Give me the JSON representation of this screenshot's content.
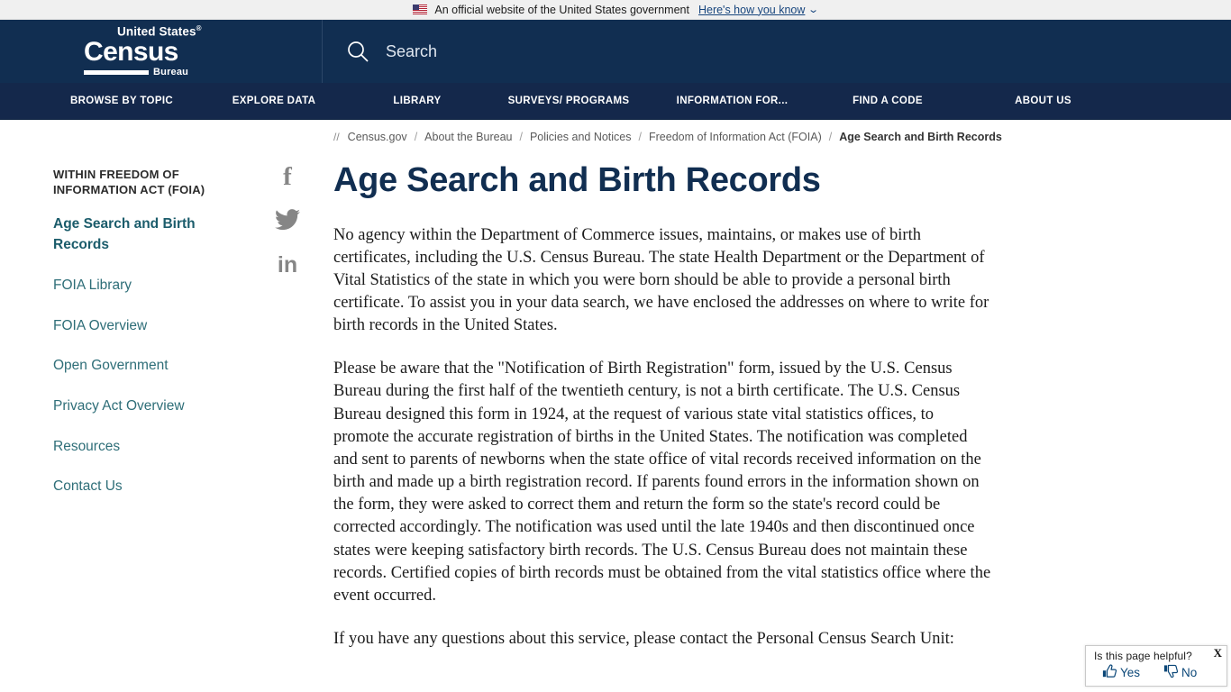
{
  "gov_banner": {
    "flag_icon": "us-flag-icon",
    "text": "An official website of the United States government",
    "link_label": "Here's how you know",
    "chevron_icon": "chevron-down-icon"
  },
  "header": {
    "logo": {
      "united_states": "United States",
      "registered_mark": "®",
      "census": "Census",
      "bureau": "Bureau"
    },
    "search": {
      "icon": "search-icon",
      "label": "Search",
      "placeholder": "Search"
    }
  },
  "main_nav": {
    "items": [
      {
        "label": "BROWSE BY TOPIC"
      },
      {
        "label": "EXPLORE DATA"
      },
      {
        "label": "LIBRARY"
      },
      {
        "label": "SURVEYS/ PROGRAMS"
      },
      {
        "label": "INFORMATION FOR..."
      },
      {
        "label": "FIND A CODE"
      },
      {
        "label": "ABOUT US"
      }
    ]
  },
  "breadcrumb": {
    "prefix": "//",
    "items": [
      {
        "label": "Census.gov",
        "current": false
      },
      {
        "label": "About the Bureau",
        "current": false
      },
      {
        "label": "Policies and Notices",
        "current": false
      },
      {
        "label": "Freedom of Information Act (FOIA)",
        "current": false
      },
      {
        "label": "Age Search and Birth Records",
        "current": true
      }
    ],
    "separator": "/"
  },
  "sidebar": {
    "section_title": "WITHIN FREEDOM OF INFORMATION ACT (FOIA)",
    "items": [
      {
        "label": "Age Search and Birth Records",
        "active": true
      },
      {
        "label": "FOIA Library",
        "active": false
      },
      {
        "label": "FOIA Overview",
        "active": false
      },
      {
        "label": "Open Government",
        "active": false
      },
      {
        "label": "Privacy Act Overview",
        "active": false
      },
      {
        "label": "Resources",
        "active": false
      },
      {
        "label": "Contact Us",
        "active": false
      }
    ],
    "social": [
      {
        "icon": "facebook-icon",
        "glyph": "f"
      },
      {
        "icon": "twitter-icon",
        "glyph": ""
      },
      {
        "icon": "linkedin-icon",
        "glyph": "in"
      }
    ]
  },
  "main": {
    "title": "Age Search and Birth Records",
    "paragraphs": [
      "No agency within the Department of Commerce issues, maintains, or makes use of birth certificates, including the U.S. Census Bureau. The state Health Department or the Department of Vital Statistics of the state in which you were born should be able to provide a personal birth certificate. To assist you in your data search, we have enclosed the addresses on where to write for birth records in the United States.",
      "Please be aware that the \"Notification of Birth Registration\" form, issued by the U.S. Census Bureau during the first half of the twentieth century, is not a birth certificate. The U.S. Census Bureau designed this form in 1924, at the request of various state vital statistics offices, to promote the accurate registration of births in the United States. The notification was completed and sent to parents of newborns when the state office of vital records received information on the birth and made up a birth registration record. If parents found errors in the information shown on the form, they were asked to correct them and return the form so the state's record could be corrected accordingly. The notification was used until the late 1940s and then discontinued once states were keeping satisfactory birth records. The U.S. Census Bureau does not maintain these records. Certified copies of birth records must be obtained from the vital statistics office where the event occurred.",
      "If you have any questions about this service, please contact the Personal Census Search Unit:"
    ]
  },
  "feedback": {
    "question": "Is this page helpful?",
    "close_label": "X",
    "yes_label": "Yes",
    "no_label": "No",
    "thumbs_up_icon": "thumbs-up-icon",
    "thumbs_down_icon": "thumbs-down-icon"
  },
  "colors": {
    "header_navy": "#112e51",
    "nav_navy": "#14284b",
    "banner_gray": "#f0f0f0",
    "link_teal": "#2e6e78",
    "breadcrumb_gray": "#5a5a5a",
    "feedback_blue": "#0b4778"
  }
}
